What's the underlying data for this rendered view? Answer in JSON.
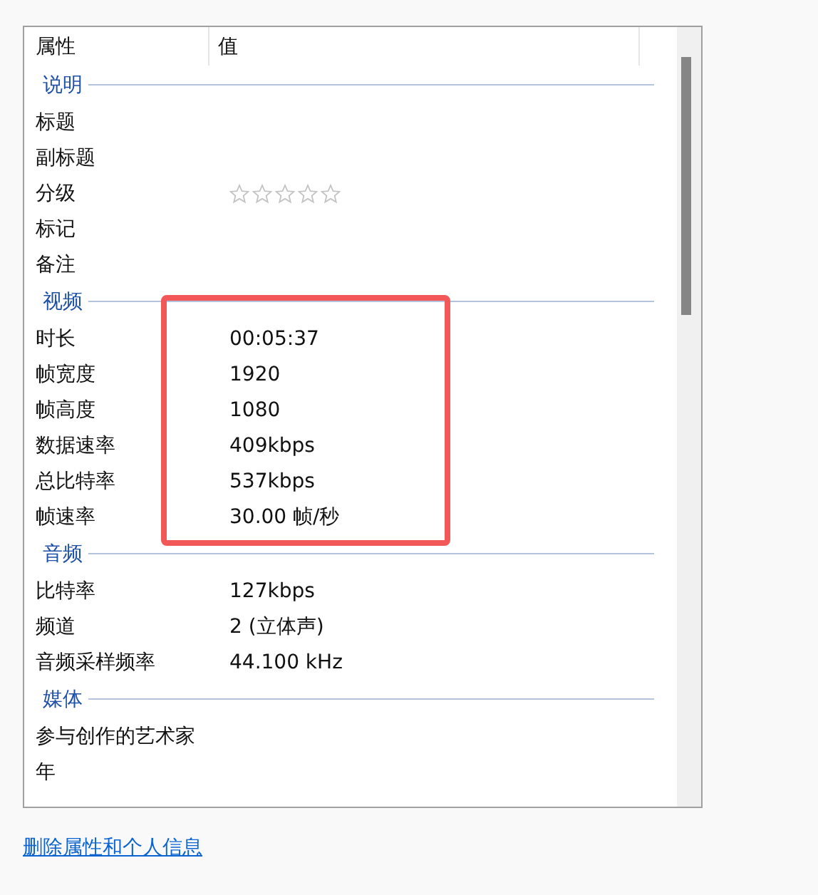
{
  "columns": [
    "属性",
    "值"
  ],
  "sections": [
    {
      "title": "说明",
      "highlighted": false,
      "rows": [
        {
          "kind": "text",
          "name": "标题"
        },
        {
          "kind": "text",
          "name": "副标题"
        },
        {
          "kind": "stars",
          "name": "分级",
          "stars": 0
        },
        {
          "kind": "text",
          "name": "标记"
        },
        {
          "kind": "text",
          "name": "备注"
        }
      ]
    },
    {
      "title": "视频",
      "highlighted": true,
      "rows": [
        {
          "kind": "text",
          "name": "时长",
          "value": "00:05:37"
        },
        {
          "kind": "text",
          "name": "帧宽度",
          "value": "1920"
        },
        {
          "kind": "text",
          "name": "帧高度",
          "value": "1080"
        },
        {
          "kind": "text",
          "name": "数据速率",
          "value": "409kbps"
        },
        {
          "kind": "text",
          "name": "总比特率",
          "value": "537kbps"
        },
        {
          "kind": "text",
          "name": "帧速率",
          "value": "30.00 帧/秒"
        }
      ]
    },
    {
      "title": "音频",
      "highlighted": false,
      "rows": [
        {
          "kind": "text",
          "name": "比特率",
          "value": "127kbps"
        },
        {
          "kind": "text",
          "name": "频道",
          "value": "2 (立体声)"
        },
        {
          "kind": "text",
          "name": "音频采样频率",
          "value": "44.100 kHz"
        }
      ]
    },
    {
      "title": "媒体",
      "highlighted": false,
      "rows": [
        {
          "kind": "text",
          "name": "参与创作的艺术家"
        },
        {
          "kind": "text",
          "name": "年"
        }
      ]
    }
  ],
  "link": "删除属性和个人信息"
}
